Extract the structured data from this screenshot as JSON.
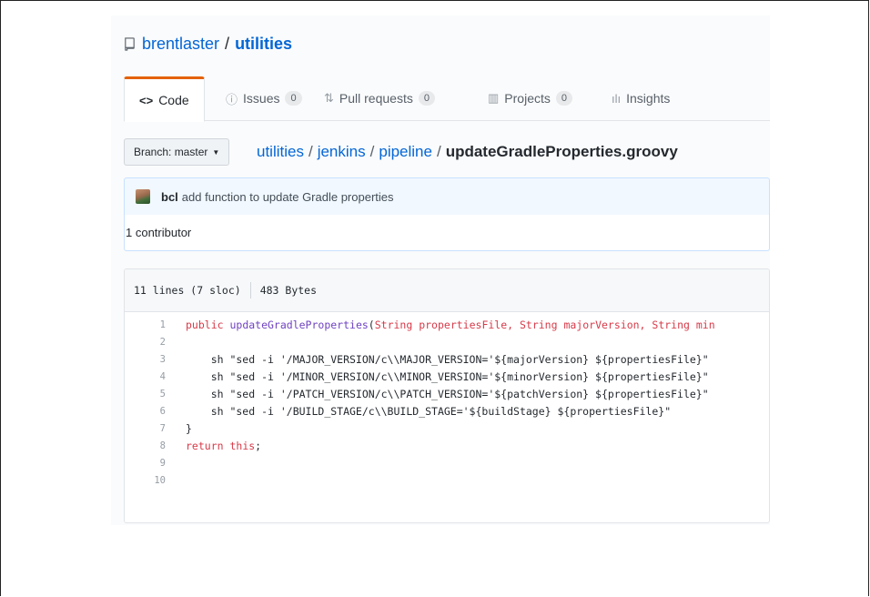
{
  "repo": {
    "owner": "brentlaster",
    "separator": "/",
    "name": "utilities"
  },
  "tabs": [
    {
      "icon": "code-icon",
      "glyph": "<>",
      "label": "Code",
      "selected": true
    },
    {
      "icon": "issue-icon",
      "glyph": "ⓘ",
      "label": "Issues",
      "count": "0"
    },
    {
      "icon": "pull-request-icon",
      "glyph": "⇅",
      "label": "Pull requests",
      "count": "0"
    },
    {
      "icon": "projects-icon",
      "glyph": "▥",
      "label": "Projects",
      "count": "0"
    },
    {
      "icon": "insights-icon",
      "glyph": "ılı",
      "label": "Insights"
    }
  ],
  "branch": {
    "label": "Branch: master"
  },
  "breadcrumb": {
    "parts": [
      "utilities",
      "jenkins",
      "pipeline"
    ],
    "file": "updateGradleProperties.groovy",
    "sep": "/"
  },
  "commit": {
    "author": "bcl",
    "message": "add function to update Gradle properties"
  },
  "contributors": "1 contributor",
  "file_info": {
    "lines": "11 lines (7 sloc)",
    "size": "483 Bytes"
  },
  "code_lines": [
    {
      "n": "1",
      "kw1": "public ",
      "fn": "updateGradleProperties",
      "rest1": "(",
      "kw2": "String ",
      "rest2": "propertiesFile, ",
      "kw3": "String ",
      "rest3": "majorVersion, ",
      "kw4": "String ",
      "rest4": "min"
    },
    {
      "n": "2",
      "text": ""
    },
    {
      "n": "3",
      "text": "    sh \"sed -i '/MAJOR_VERSION/c\\\\MAJOR_VERSION='${majorVersion} ${propertiesFile}\""
    },
    {
      "n": "4",
      "text": "    sh \"sed -i '/MINOR_VERSION/c\\\\MINOR_VERSION='${minorVersion} ${propertiesFile}\""
    },
    {
      "n": "5",
      "text": "    sh \"sed -i '/PATCH_VERSION/c\\\\PATCH_VERSION='${patchVersion} ${propertiesFile}\""
    },
    {
      "n": "6",
      "text": "    sh \"sed -i '/BUILD_STAGE/c\\\\BUILD_STAGE='${buildStage} ${propertiesFile}\""
    },
    {
      "n": "7",
      "text": "}"
    },
    {
      "n": "8",
      "kwa": "return ",
      "kwb": "this",
      "tail": ";"
    },
    {
      "n": "9",
      "text": ""
    },
    {
      "n": "10",
      "text": ""
    }
  ]
}
